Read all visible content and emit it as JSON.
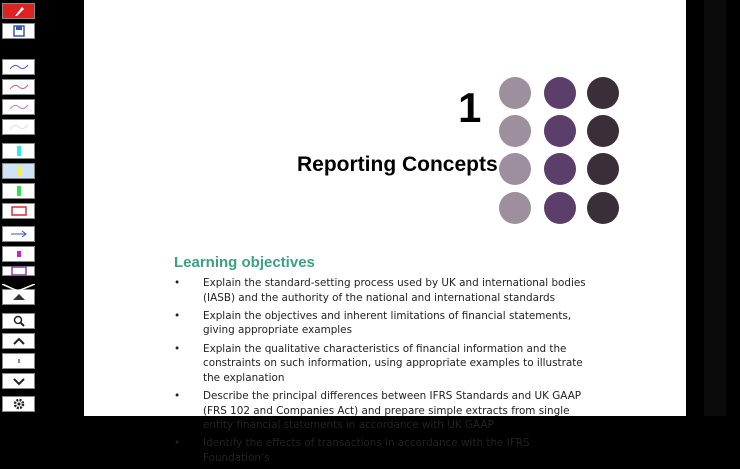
{
  "toolbar": {
    "buttons": [
      {
        "name": "pen-logo-icon",
        "kind": "logo"
      },
      {
        "name": "save-icon",
        "kind": "save"
      },
      {
        "name": "pen-blue-icon",
        "kind": "pen",
        "color": "#4a5fd6"
      },
      {
        "name": "pen-pink-icon",
        "kind": "pen",
        "color": "#e05a8a"
      },
      {
        "name": "pen-purple-icon",
        "kind": "pen",
        "color": "#c17ad8"
      },
      {
        "name": "pen-white-icon",
        "kind": "pen",
        "color": "#dddddd"
      },
      {
        "name": "highlighter-cyan-icon",
        "kind": "highlighter",
        "color": "#2fe8f0"
      },
      {
        "name": "highlighter-yellow-icon",
        "kind": "highlighter",
        "color": "#f7ee4a"
      },
      {
        "name": "highlighter-green-icon",
        "kind": "highlighter",
        "color": "#31e24a"
      },
      {
        "name": "rectangle-icon",
        "kind": "rect",
        "color": "#d03030"
      },
      {
        "name": "arrow-icon",
        "kind": "arrow",
        "color": "#4050d8"
      },
      {
        "name": "marker-magenta-icon",
        "kind": "small",
        "color": "#d020c0"
      },
      {
        "name": "rectangle-purple-icon",
        "kind": "rect",
        "color": "#8040a0"
      },
      {
        "name": "scroll-up-icon",
        "kind": "up"
      },
      {
        "name": "zoom-icon",
        "kind": "zoom"
      },
      {
        "name": "chevron-up-icon",
        "kind": "chevup"
      },
      {
        "name": "page-marker-icon",
        "kind": "tiny"
      },
      {
        "name": "chevron-down-icon",
        "kind": "chevdown"
      },
      {
        "name": "settings-gear-icon",
        "kind": "gear"
      }
    ]
  },
  "chapter": {
    "number": "1",
    "title": "Reporting Concepts"
  },
  "dot_colors": [
    "#9d8f9e",
    "#5c3e6a",
    "#3a2e38"
  ],
  "learning_objectives": {
    "title": "Learning objectives",
    "bullet": "•",
    "items": [
      "Explain the standard-setting process used by UK and international bodies (IASB) and the authority of the national and international standards",
      "Explain the objectives and inherent limitations of financial statements, giving appropriate examples",
      "Explain the qualitative characteristics of financial information and the constraints on such information, using appropriate examples to illustrate the explanation",
      "Describe the principal differences between IFRS Standards and UK GAAP (FRS 102 and Companies Act) and prepare simple extracts from single entity financial statements in accordance with UK GAAP",
      "Identify the effects of transactions in accordance with the IFRS Foundation’s"
    ]
  }
}
